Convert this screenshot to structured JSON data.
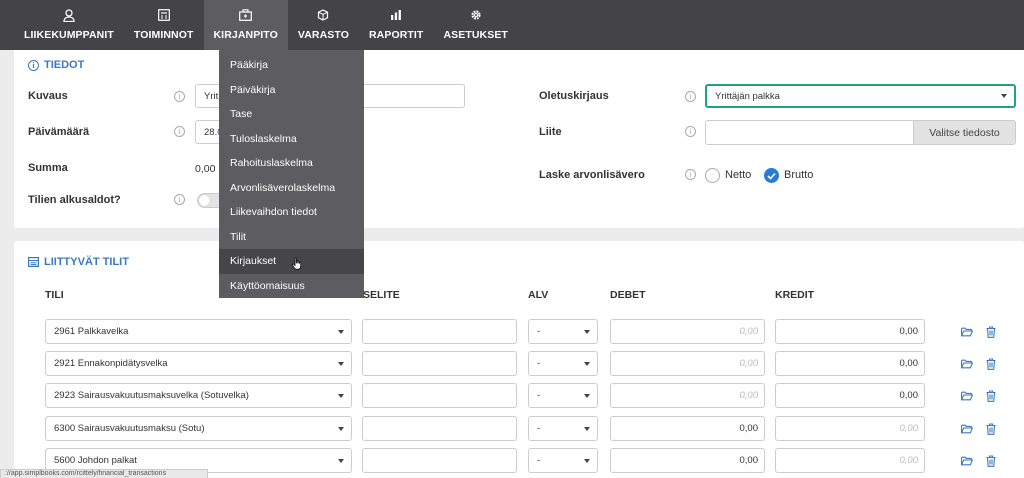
{
  "nav": [
    {
      "label": "LIIKEKUMPPANIT",
      "icon": "person-icon"
    },
    {
      "label": "TOIMINNOT",
      "icon": "calculator-icon"
    },
    {
      "label": "KIRJANPITO",
      "icon": "briefcase-icon"
    },
    {
      "label": "VARASTO",
      "icon": "cubes-icon"
    },
    {
      "label": "RAPORTIT",
      "icon": "bar-chart-icon"
    },
    {
      "label": "ASETUKSET",
      "icon": "gear-icon"
    }
  ],
  "dropdown": {
    "items": [
      "Pääkirja",
      "Päiväkirja",
      "Tase",
      "Tuloslaskelma",
      "Rahoituslaskelma",
      "Arvonlisäverolaskelma",
      "Liikevaihdon tiedot",
      "Tilit",
      "Kirjaukset",
      "Käyttöomaisuus"
    ],
    "highlighted": "Kirjaukset"
  },
  "tiedot": {
    "title": "TIEDOT",
    "kuvaus_label": "Kuvaus",
    "kuvaus_value": "Yrit",
    "paivamaara_label": "Päivämäärä",
    "paivamaara_value": "28.0",
    "summa_label": "Summa",
    "summa_value": "0,00",
    "alkusaldot_label": "Tilien alkusaldot?",
    "oletuskirjaus_label": "Oletuskirjaus",
    "oletuskirjaus_value": "Yrittäjän palkka",
    "liite_label": "Liite",
    "liite_button": "Valitse tiedosto",
    "alv_label": "Laske arvonlisävero",
    "netto": "Netto",
    "brutto": "Brutto",
    "selected_vat": "Brutto"
  },
  "liittyvat": {
    "title": "LIITTYVÄT TILIT",
    "headers": {
      "tili": "TILI",
      "selite": "SELITE",
      "alv": "ALV",
      "debet": "DEBET",
      "kredit": "KREDIT"
    },
    "rows": [
      {
        "tili": "2961 Palkkavelka",
        "alv": "-",
        "debet": "0,00",
        "kredit": "0,00",
        "debet_placeholder": true,
        "kredit_placeholder": false
      },
      {
        "tili": "2921 Ennakonpidätysvelka",
        "alv": "-",
        "debet": "0,00",
        "kredit": "0,00",
        "debet_placeholder": true,
        "kredit_placeholder": false
      },
      {
        "tili": "2923 Sairausvakuutusmaksuvelka (Sotuvelka)",
        "alv": "-",
        "debet": "0,00",
        "kredit": "0,00",
        "debet_placeholder": true,
        "kredit_placeholder": false
      },
      {
        "tili": "6300 Sairausvakuutusmaksu (Sotu)",
        "alv": "-",
        "debet": "0,00",
        "kredit": "0,00",
        "debet_placeholder": false,
        "kredit_placeholder": true
      },
      {
        "tili": "5600 Johdon palkat",
        "alv": "-",
        "debet": "0,00",
        "kredit": "0,00",
        "debet_placeholder": false,
        "kredit_placeholder": true
      }
    ]
  },
  "status_url": "://app.simplbooks.com/rcittely/financial_transactions",
  "colors": {
    "accent": "#3a78c3",
    "nav_bg": "#444448",
    "dropdown_bg": "#5c5c61",
    "highlight_border": "#1fa37a"
  }
}
